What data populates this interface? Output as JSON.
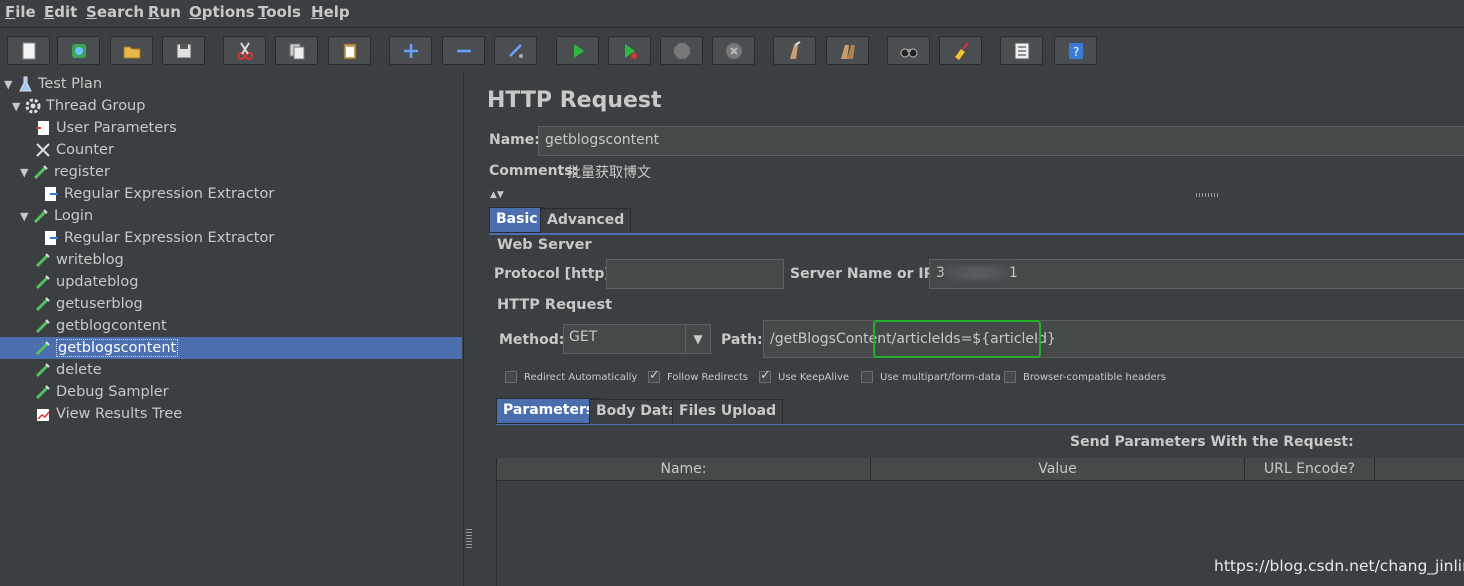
{
  "menubar": {
    "items": [
      {
        "first": "F",
        "rest": "ile"
      },
      {
        "first": "E",
        "rest": "dit"
      },
      {
        "first": "S",
        "rest": "earch"
      },
      {
        "first": "R",
        "rest": "un"
      },
      {
        "first": "O",
        "rest": "ptions"
      },
      {
        "first": "T",
        "rest": "ools"
      },
      {
        "first": "H",
        "rest": "elp"
      }
    ]
  },
  "toolbar": {
    "icons": [
      "new-icon",
      "templates-icon",
      "open-icon",
      "save-icon",
      "cut-icon",
      "copy-icon",
      "paste-icon",
      "expand-icon",
      "collapse-icon",
      "toggle-icon",
      "start-icon",
      "start-no-pauses-icon",
      "stop-icon",
      "shutdown-icon",
      "clear-icon",
      "clear-all-icon",
      "search-icon",
      "reset-search-icon",
      "function-helper-icon",
      "help-icon"
    ]
  },
  "tree": {
    "items": [
      {
        "label": "Test Plan",
        "icon": "test-plan-icon"
      },
      {
        "label": "Thread Group",
        "icon": "gear-icon"
      },
      {
        "label": "User Parameters",
        "icon": "document-icon"
      },
      {
        "label": "Counter",
        "icon": "tools-icon"
      },
      {
        "label": "register",
        "icon": "sampler-pipette-icon"
      },
      {
        "label": "Regular Expression Extractor",
        "icon": "document-arrow-icon"
      },
      {
        "label": "Login",
        "icon": "sampler-pipette-icon"
      },
      {
        "label": "Regular Expression Extractor",
        "icon": "document-arrow-icon"
      },
      {
        "label": "writeblog",
        "icon": "sampler-pipette-icon"
      },
      {
        "label": "updateblog",
        "icon": "sampler-pipette-icon"
      },
      {
        "label": "getuserblog",
        "icon": "sampler-pipette-icon"
      },
      {
        "label": "getblogcontent",
        "icon": "sampler-pipette-icon"
      },
      {
        "label": "getblogscontent",
        "icon": "sampler-pipette-icon"
      },
      {
        "label": "delete",
        "icon": "sampler-pipette-icon"
      },
      {
        "label": "Debug Sampler",
        "icon": "sampler-pipette-icon"
      },
      {
        "label": "View Results Tree",
        "icon": "chart-icon"
      }
    ]
  },
  "panel": {
    "title": "HTTP Request",
    "name_label": "Name:",
    "name_value": "getblogscontent",
    "comments_label": "Comments:",
    "comments_value": "批量获取博文",
    "tabs": [
      "Basic",
      "Advanced"
    ],
    "web_server": {
      "title": "Web Server",
      "protocol_label": "Protocol [http]:",
      "protocol_value": "",
      "server_label": "Server Name or IP:",
      "server_prefix": "3",
      "server_suffix": "1"
    },
    "http_request": {
      "title": "HTTP Request",
      "method_label": "Method:",
      "method_value": "GET",
      "path_label": "Path:",
      "path_value": "/getBlogsContent/articleIds=${articleId}"
    },
    "options": [
      {
        "label": "Redirect Automatically",
        "checked": false
      },
      {
        "label": "Follow Redirects",
        "checked": true
      },
      {
        "label": "Use KeepAlive",
        "checked": true
      },
      {
        "label": "Use multipart/form-data",
        "checked": false
      },
      {
        "label": "Browser-compatible headers",
        "checked": false
      }
    ],
    "param_tabs": [
      "Parameters",
      "Body Data",
      "Files Upload"
    ],
    "params_title": "Send Parameters With the Request:",
    "columns": [
      "Name:",
      "Value",
      "URL Encode?"
    ]
  },
  "colors": {
    "selection": "#4b6eaf",
    "highlight_box": "#22b02a"
  },
  "watermark": "https://blog.csdn.net/chang_jinling"
}
